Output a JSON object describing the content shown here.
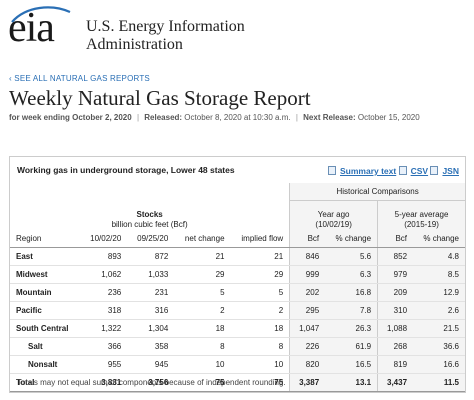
{
  "header": {
    "logo_text": "eia",
    "org_line1": "U.S. Energy Information",
    "org_line2": "Administration"
  },
  "nav": {
    "back_link": "‹ SEE ALL NATURAL GAS REPORTS"
  },
  "page": {
    "title": "Weekly Natural Gas Storage Report",
    "week_label": "for week ending October 2, 2020",
    "released_label": "Released:",
    "released_value": "October 8, 2020 at 10:30 a.m.",
    "next_label": "Next Release:",
    "next_value": "October 15, 2020"
  },
  "table": {
    "caption": "Working gas in underground storage, Lower 48 states",
    "downloads": {
      "summary": "Summary text",
      "csv": "CSV",
      "json": "JSN"
    },
    "historical_title": "Historical Comparisons",
    "stocks_title": "Stocks",
    "stocks_unit": "billion cubic feet (Bcf)",
    "year_ago_title": "Year ago",
    "year_ago_date": "(10/02/19)",
    "five_year_title": "5-year average",
    "five_year_range": "(2015-19)",
    "columns": [
      "Region",
      "10/02/20",
      "09/25/20",
      "net change",
      "implied flow",
      "Bcf",
      "% change",
      "Bcf",
      "% change"
    ],
    "rows": [
      {
        "region": "East",
        "cur": "893",
        "prev": "872",
        "net": "21",
        "flow": "21",
        "ya_bcf": "846",
        "ya_pct": "5.6",
        "fy_bcf": "852",
        "fy_pct": "4.8",
        "sub": false
      },
      {
        "region": "Midwest",
        "cur": "1,062",
        "prev": "1,033",
        "net": "29",
        "flow": "29",
        "ya_bcf": "999",
        "ya_pct": "6.3",
        "fy_bcf": "979",
        "fy_pct": "8.5",
        "sub": false
      },
      {
        "region": "Mountain",
        "cur": "236",
        "prev": "231",
        "net": "5",
        "flow": "5",
        "ya_bcf": "202",
        "ya_pct": "16.8",
        "fy_bcf": "209",
        "fy_pct": "12.9",
        "sub": false
      },
      {
        "region": "Pacific",
        "cur": "318",
        "prev": "316",
        "net": "2",
        "flow": "2",
        "ya_bcf": "295",
        "ya_pct": "7.8",
        "fy_bcf": "310",
        "fy_pct": "2.6",
        "sub": false
      },
      {
        "region": "South Central",
        "cur": "1,322",
        "prev": "1,304",
        "net": "18",
        "flow": "18",
        "ya_bcf": "1,047",
        "ya_pct": "26.3",
        "fy_bcf": "1,088",
        "fy_pct": "21.5",
        "sub": false
      },
      {
        "region": "Salt",
        "cur": "366",
        "prev": "358",
        "net": "8",
        "flow": "8",
        "ya_bcf": "226",
        "ya_pct": "61.9",
        "fy_bcf": "268",
        "fy_pct": "36.6",
        "sub": true
      },
      {
        "region": "Nonsalt",
        "cur": "955",
        "prev": "945",
        "net": "10",
        "flow": "10",
        "ya_bcf": "820",
        "ya_pct": "16.5",
        "fy_bcf": "819",
        "fy_pct": "16.6",
        "sub": true
      },
      {
        "region": "Total",
        "cur": "3,831",
        "prev": "3,756",
        "net": "75",
        "flow": "75",
        "ya_bcf": "3,387",
        "ya_pct": "13.1",
        "fy_bcf": "3,437",
        "fy_pct": "11.5",
        "sub": false,
        "total": true
      }
    ],
    "footnote": "Totals may not equal sum of components because of independent rounding."
  },
  "colors": {
    "link": "#2a6fb5",
    "logo_swoosh": "#2a6fb5",
    "panel_shade": "#f4f4f4"
  }
}
